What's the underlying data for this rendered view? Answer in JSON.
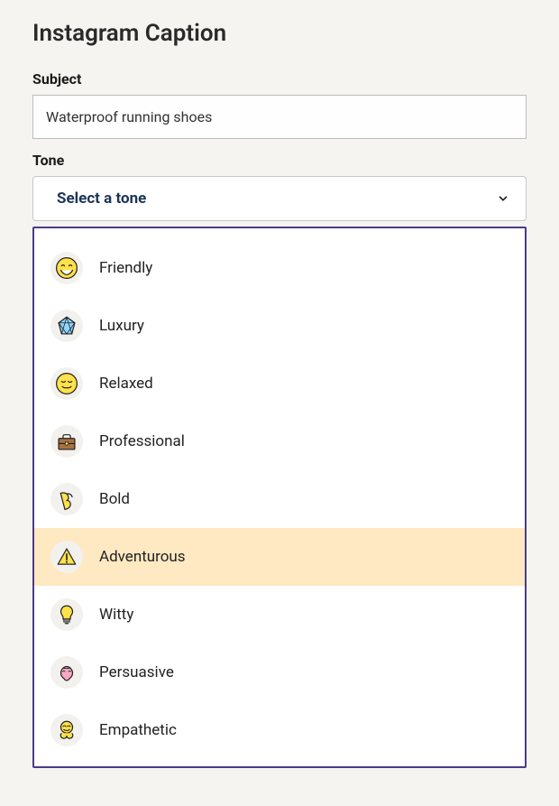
{
  "page_title": "Instagram Caption",
  "subject": {
    "label": "Subject",
    "value": "Waterproof running shoes"
  },
  "tone": {
    "label": "Tone",
    "placeholder": "Select a tone",
    "highlighted_index": 5,
    "options": [
      {
        "icon": "friendly",
        "label": "Friendly"
      },
      {
        "icon": "luxury",
        "label": "Luxury"
      },
      {
        "icon": "relaxed",
        "label": "Relaxed"
      },
      {
        "icon": "professional",
        "label": "Professional"
      },
      {
        "icon": "bold",
        "label": "Bold"
      },
      {
        "icon": "adventurous",
        "label": "Adventurous"
      },
      {
        "icon": "witty",
        "label": "Witty"
      },
      {
        "icon": "persuasive",
        "label": "Persuasive"
      },
      {
        "icon": "empathetic",
        "label": "Empathetic"
      }
    ]
  }
}
